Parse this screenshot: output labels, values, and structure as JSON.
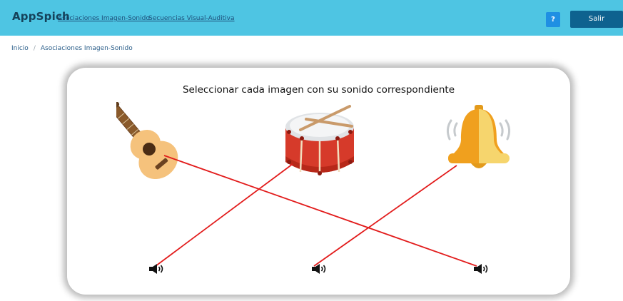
{
  "navbar": {
    "brand": "AppSpich",
    "links": [
      "Asociaciones Imagen-Sonido",
      "Secuencias Visual-Auditiva"
    ],
    "help_label": "?",
    "exit_label": "Salir"
  },
  "breadcrumb": [
    "Inicio",
    "Asociaciones Imagen-Sonido"
  ],
  "activity": {
    "instruction": "Seleccionar cada imagen con su sonido correspondiente",
    "images": [
      "guitar-icon",
      "drum-icon",
      "bell-icon"
    ],
    "sounds": [
      "speaker-icon",
      "speaker-icon",
      "speaker-icon"
    ]
  },
  "colors": {
    "navbar": "#4ec5e3",
    "help_button": "#1f8fe3",
    "exit_button": "#0e628f",
    "connection_line": "#e21b1b"
  }
}
